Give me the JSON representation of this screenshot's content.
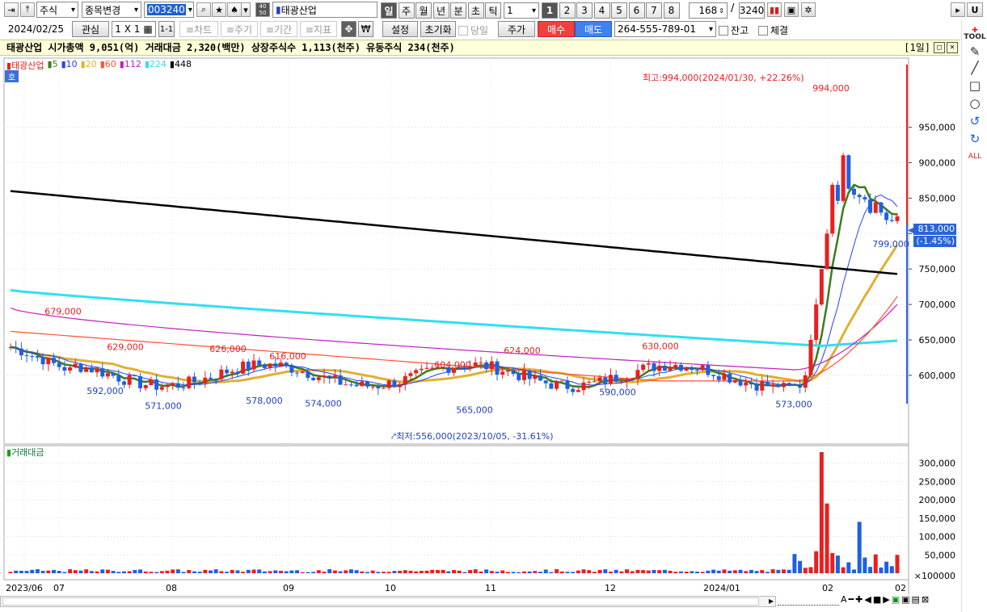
{
  "toolbar": {
    "market_type": "주식",
    "change_item": "종목변경",
    "code": "003240",
    "stock_name": "태광산업",
    "periods": [
      "일",
      "주",
      "월",
      "년",
      "분",
      "초",
      "틱"
    ],
    "period_value": "1",
    "chart_counts": [
      "1",
      "2",
      "3",
      "4",
      "5",
      "6",
      "7",
      "8"
    ],
    "count_value": "168",
    "count_total": "3240",
    "slash": "/",
    "right_box": "U",
    "side_box": "▸"
  },
  "toolbar2": {
    "date": "2024/02/25",
    "interest": "관심",
    "layout": "1 X 1",
    "one_one": "1-1",
    "chart_btn": "≡차트",
    "cycle_btn": "≡주기",
    "period_btn": "≡기간",
    "indicator_btn": "≡지표",
    "move_icon": "✥",
    "won_icon": "₩",
    "settings": "설정",
    "reset": "초기화",
    "sameday": "당일",
    "price": "주가",
    "buy": "매수",
    "sell": "매도",
    "account": "264-555-789-01",
    "balance": "잔고",
    "executed": "체결"
  },
  "infobar": {
    "text": "태광산업  시가총액 9,051(억)  거래대금 2,320(백만)  상장주식수 1,113(천주)  유동주식 234(천주)",
    "tag": "[1일]"
  },
  "chart_data": {
    "type": "candlestick",
    "name": "태광산업",
    "legend": [
      {
        "name": "태광산업",
        "color": "#e8201e"
      },
      {
        "name": "5",
        "color": "#3a7d1e"
      },
      {
        "name": "10",
        "color": "#2040ff"
      },
      {
        "name": "20",
        "color": "#e0b030"
      },
      {
        "name": "60",
        "color": "#ff5030"
      },
      {
        "name": "112",
        "color": "#c020c0"
      },
      {
        "name": "224",
        "color": "#30e0f0"
      },
      {
        "name": "448",
        "color": "#000000"
      }
    ],
    "y_ticks": [
      "950,000",
      "900,000",
      "850,000",
      "800,000",
      "750,000",
      "700,000",
      "650,000",
      "600,000"
    ],
    "ylim": [
      570000,
      1000000
    ],
    "current_price": "813,000",
    "current_change": "(-1.45%)",
    "annotations": {
      "high_note": "최고:994,000(2024/01/30, +22.26%)",
      "low_note": "최저:556,000(2023/10/05, -31.61%)",
      "labels_red": [
        {
          "text": "994,000",
          "x": 1028
        },
        {
          "text": "679,000",
          "x": 78
        },
        {
          "text": "629,000",
          "x": 155
        },
        {
          "text": "626,000",
          "x": 282
        },
        {
          "text": "616,000",
          "x": 356
        },
        {
          "text": "604,000",
          "x": 560
        },
        {
          "text": "624,000",
          "x": 646
        },
        {
          "text": "630,000",
          "x": 817
        }
      ],
      "labels_blue": [
        {
          "text": "592,000",
          "x": 130
        },
        {
          "text": "571,000",
          "x": 202
        },
        {
          "text": "578,000",
          "x": 327
        },
        {
          "text": "574,000",
          "x": 400
        },
        {
          "text": "565,000",
          "x": 587
        },
        {
          "text": "590,000",
          "x": 764
        },
        {
          "text": "573,000",
          "x": 982
        },
        {
          "text": "799,000",
          "x": 1102
        }
      ]
    },
    "volume": {
      "title": "거래대금",
      "y_ticks": [
        "300,000",
        "250,000",
        "200,000",
        "150,000",
        "100,000",
        "50,000"
      ],
      "unit": "×100000"
    },
    "x_labels": [
      {
        "text": "2023/06",
        "x": 30
      },
      {
        "text": "07",
        "x": 73
      },
      {
        "text": "08",
        "x": 212
      },
      {
        "text": "09",
        "x": 357
      },
      {
        "text": "10",
        "x": 483
      },
      {
        "text": "11",
        "x": 607
      },
      {
        "text": "12",
        "x": 755
      },
      {
        "text": "2024/01",
        "x": 893
      },
      {
        "text": "02",
        "x": 1024
      },
      {
        "text": "02",
        "x": 1114
      }
    ]
  },
  "ho_badge": "호",
  "status": {
    "scroll_left": "◂",
    "scroll_right": "▸"
  }
}
